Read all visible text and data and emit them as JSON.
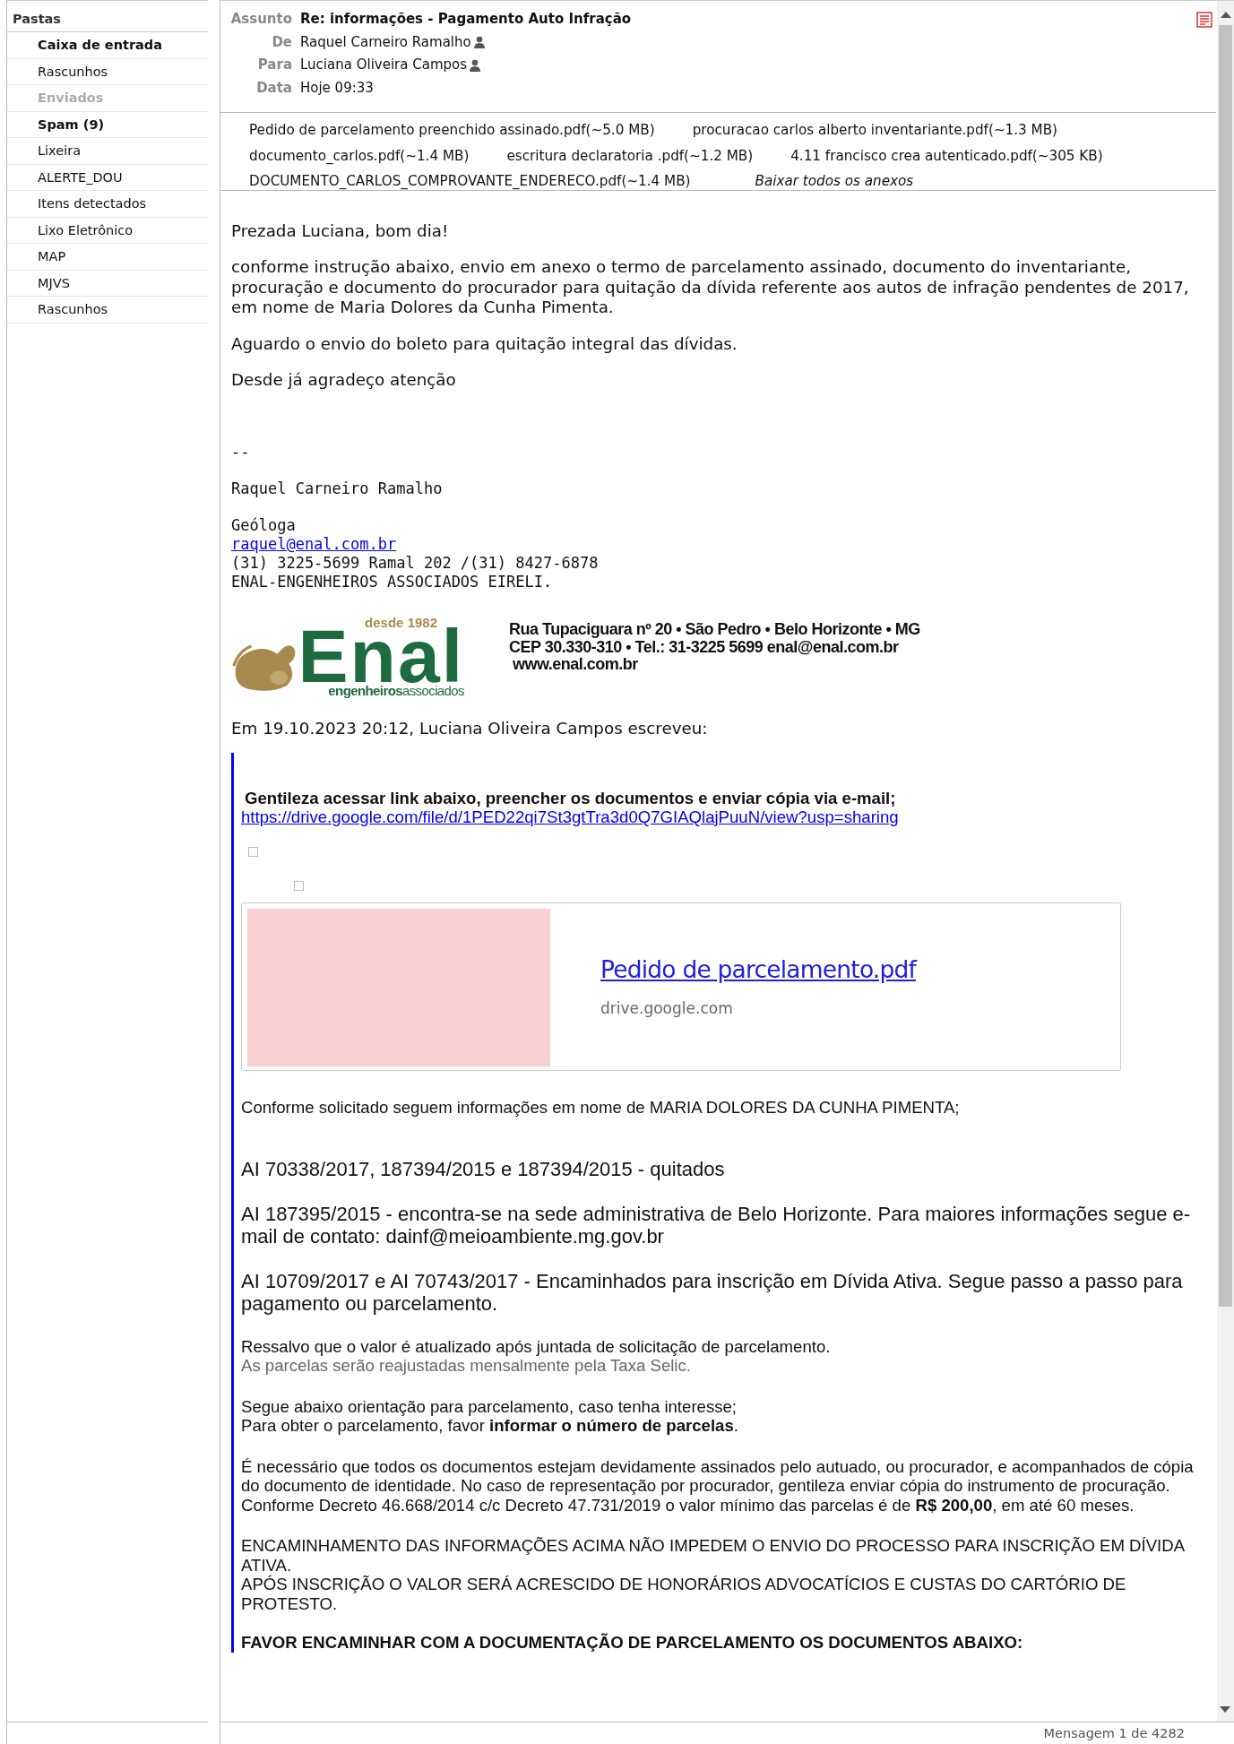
{
  "sidebar": {
    "title": "Pastas",
    "items": [
      {
        "label": "Caixa de entrada",
        "kind": "bold"
      },
      {
        "label": "Rascunhos",
        "kind": "normal"
      },
      {
        "label": "Enviados",
        "kind": "greyed"
      },
      {
        "label": "Spam (9)",
        "kind": "bold"
      },
      {
        "label": "Lixeira",
        "kind": "normal"
      },
      {
        "label": "ALERTE_DOU",
        "kind": "normal"
      },
      {
        "label": "Itens detectados",
        "kind": "normal"
      },
      {
        "label": "Lixo Eletrônico",
        "kind": "normal"
      },
      {
        "label": "MAP",
        "kind": "normal"
      },
      {
        "label": "MJVS",
        "kind": "normal"
      },
      {
        "label": "Rascunhos",
        "kind": "normal"
      }
    ]
  },
  "header": [
    {
      "label": "Assunto",
      "value": "Re: informações - Pagamento Auto Infração",
      "kind": "subject"
    },
    {
      "label": "De",
      "value": "Raquel Carneiro Ramalho",
      "kind": "person"
    },
    {
      "label": "Para",
      "value": "Luciana Oliveira Campos",
      "kind": "person"
    },
    {
      "label": "Data",
      "value": "Hoje 09:33",
      "kind": "plain"
    }
  ],
  "attachments": [
    [
      "Pedido de parcelamento preenchido assinado.pdf(~5.0 MB)",
      "procuracao carlos alberto inventariante.pdf(~1.3 MB)"
    ],
    [
      "documento_carlos.pdf(~1.4 MB)",
      "escritura declaratoria .pdf(~1.2 MB)",
      "4.11 francisco crea autenticado.pdf(~305 KB)"
    ],
    [
      "DOCUMENTO_CARLOS_COMPROVANTE_ENDERECO.pdf(~1.4 MB)"
    ]
  ],
  "download_all": "Baixar todos os anexos",
  "body": {
    "greeting": "Prezada Luciana, bom dia!",
    "paragraphs": [
      "conforme instrução abaixo, envio em anexo o termo de parcelamento assinado, documento do inventariante, procuração e documento do procurador para quitação da dívida referente aos autos de infração pendentes de 2017, em nome de Maria Dolores da Cunha Pimenta.",
      "Aguardo o envio do boleto para quitação integral das dívidas.",
      "Desde já agradeço  atenção"
    ],
    "signature": {
      "separator": "--",
      "name": "Raquel Carneiro Ramalho",
      "role": "Geóloga",
      "email": "raquel@enal.com.br",
      "phone": "(31) 3225-5699 Ramal 202 /(31) 8427-6878",
      "company": "ENAL-ENGENHEIROS ASSOCIADOS EIRELI."
    },
    "logo": {
      "tagline": "desde 1982",
      "wordmark": "Enal",
      "subtitle_bold": "engenheiros",
      "subtitle": "associados",
      "address": [
        "Rua Tupaciguara nº 20  • São Pedro • Belo Horizonte • MG",
        "CEP 30.330-310 • Tel.: 31-3225 5699 enal@enal.com.br",
        "www.enal.com.br"
      ]
    },
    "quote_header": "Em 19.10.2023 20:12, Luciana Oliveira Campos escreveu:"
  },
  "quote": {
    "intro": "Gentileza acessar link abaixo, preencher os documentos e enviar cópia via e-mail;",
    "link": "https://drive.google.com/file/d/1PED22qi7St3gtTra3d0Q7GIAQlajPuuN/view?usp=sharing",
    "card": {
      "title": "Pedido de parcelamento.pdf",
      "domain": "drive.google.com"
    },
    "request": "Conforme solicitado seguem informações em nome de MARIA DOLORES DA CUNHA PIMENTA;",
    "items": [
      "AI  70338/2017, 187394/2015 e 187394/2015 - quitados",
      "AI 187395/2015 - encontra-se na sede administrativa de Belo Horizonte. Para maiores informações segue e-mail de contato: dainf@meioambiente.mg.gov.br",
      "AI 10709/2017 e AI 70743/2017 - Encaminhados para inscrição em Dívida Ativa. Segue passo a passo para pagamento ou parcelamento."
    ],
    "paragraphs": [
      [
        {
          "text": "Ressalvo que o valor é atualizado após juntada de solicitação de parcelamento.",
          "muted": false
        },
        {
          "text": "As parcelas serão reajustadas mensalmente pela Taxa Selic.",
          "muted": true
        }
      ],
      [
        {
          "text": "Segue abaixo orientação para parcelamento, caso tenha interesse;",
          "muted": false
        },
        {
          "text": "Para obter o parcelamento, favor **informar o número de parcelas**.",
          "muted": false
        }
      ],
      [
        {
          "text": "É necessário que todos os documentos estejam devidamente assinados pelo autuado, ou procurador, e acompanhados de cópia do documento de identidade. No caso de representação por procurador, gentileza enviar cópia do instrumento de procuração.",
          "muted": false
        },
        {
          "text": "Conforme Decreto 46.668/2014 c/c Decreto 47.731/2019 o valor mínimo das parcelas é de **R$ 200,00**, em até 60 meses.",
          "muted": false
        }
      ],
      [
        {
          "text": "ENCAMINHAMENTO DAS INFORMAÇÕES ACIMA NÃO IMPEDEM O ENVIO DO PROCESSO PARA INSCRIÇÃO EM DÍVIDA ATIVA.",
          "muted": false
        },
        {
          "text": "APÓS INSCRIÇÃO O VALOR SERÁ ACRESCIDO DE HONORÁRIOS ADVOCATÍCIOS E CUSTAS DO CARTÓRIO DE PROTESTO.",
          "muted": false
        }
      ]
    ],
    "closing": "FAVOR ENCAMINHAR COM A DOCUMENTAÇÃO DE PARCELAMENTO OS DOCUMENTOS ABAIXO:"
  },
  "status_bar": "Mensagem 1 de 4282"
}
